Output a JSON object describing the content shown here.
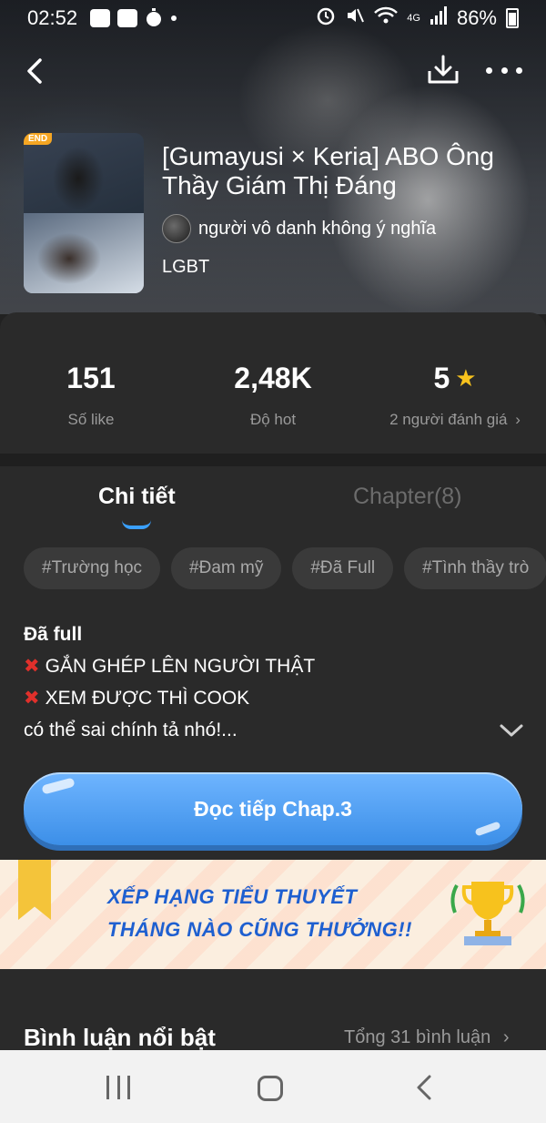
{
  "status_bar": {
    "time": "02:52",
    "network": "4G",
    "battery": "86%"
  },
  "book": {
    "badge": "END",
    "title": "[Gumayusi × Keria] ABO Ông Thầy Giám Thị Đáng",
    "author": "người vô danh không ý nghĩa",
    "genre": "LGBT"
  },
  "stats": {
    "likes_value": "151",
    "likes_label": "Số like",
    "hot_value": "2,48K",
    "hot_label": "Độ hot",
    "rating_value": "5",
    "rating_label": "2 người đánh giá"
  },
  "tabs": {
    "detail": "Chi tiết",
    "chapter": "Chapter(8)"
  },
  "tags": [
    "#Trường học",
    "#Đam mỹ",
    "#Đã Full",
    "#Tình thầy trò"
  ],
  "description": {
    "line1": "Đã full",
    "line2": "GẮN GHÉP LÊN NGƯỜI THẬT",
    "line3": "XEM ĐƯỢC THÌ COOK",
    "line4": "có thể sai chính tả nhó!..."
  },
  "cta": {
    "label": "Đọc tiếp Chap.3"
  },
  "banner": {
    "line1": "XẾP HẠNG TIỂU THUYẾT",
    "line2": "THÁNG NÀO CŨNG THƯỞNG!!"
  },
  "comments": {
    "title": "Bình luận nổi bật",
    "total": "Tổng 31 bình luận"
  },
  "colors": {
    "accent": "#3aa0ff",
    "cta": "#4a9bf0",
    "star": "#f7c21d",
    "badge": "#f5a623",
    "danger": "#e0302b",
    "banner_text": "#1e5fd0"
  }
}
